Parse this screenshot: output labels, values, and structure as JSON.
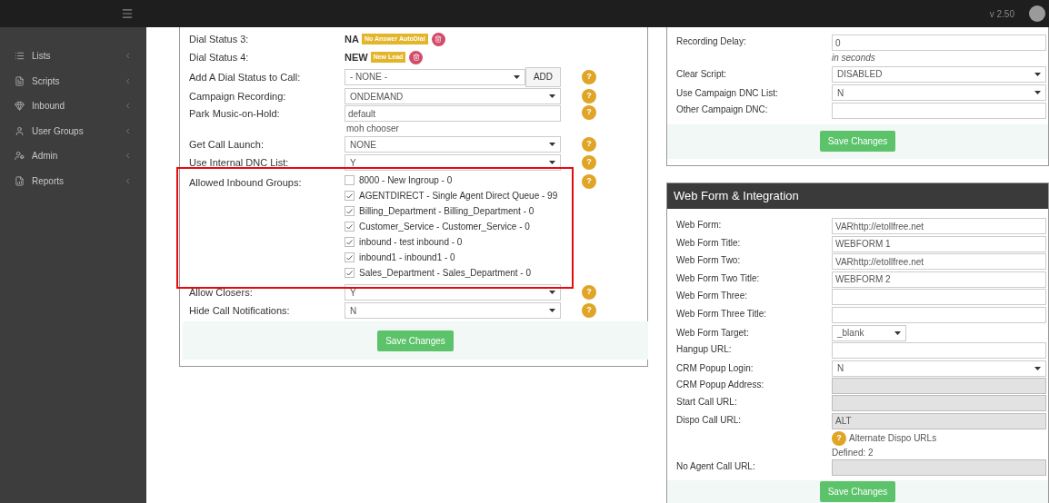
{
  "header": {
    "version": "v 2.50"
  },
  "sidebar": {
    "items": [
      {
        "label": "Lists"
      },
      {
        "label": "Scripts"
      },
      {
        "label": "Inbound"
      },
      {
        "label": "User Groups"
      },
      {
        "label": "Admin"
      },
      {
        "label": "Reports"
      }
    ]
  },
  "left_panel": {
    "rows": [
      {
        "kind": "status",
        "label": "Dial Status 3:",
        "code": "NA",
        "badge": "No Answer AutoDial"
      },
      {
        "kind": "status",
        "label": "Dial Status 4:",
        "code": "NEW",
        "badge": "New Lead"
      },
      {
        "kind": "select_add",
        "label": "Add A Dial Status to Call:",
        "value": "- NONE -",
        "button": "ADD",
        "help": "?"
      },
      {
        "kind": "select",
        "label": "Campaign Recording:",
        "value": "ONDEMAND",
        "help": "?"
      },
      {
        "kind": "input",
        "label": "Park Music-on-Hold:",
        "value": "default",
        "note": "moh chooser",
        "help": "?"
      },
      {
        "kind": "select",
        "label": "Get Call Launch:",
        "value": "NONE",
        "help": "?"
      },
      {
        "kind": "select",
        "label": "Use Internal DNC List:",
        "value": "Y",
        "help": "?"
      },
      {
        "kind": "checklist",
        "label": "Allowed Inbound Groups:",
        "help": "?",
        "highlighted": true,
        "options": [
          {
            "label": "8000 - New Ingroup - 0",
            "checked": false
          },
          {
            "label": "AGENTDIRECT - Single Agent Direct Queue - 99",
            "checked": true
          },
          {
            "label": "Billing_Department - Billing_Department - 0",
            "checked": true
          },
          {
            "label": "Customer_Service - Customer_Service - 0",
            "checked": true
          },
          {
            "label": "inbound - test inbound - 0",
            "checked": true
          },
          {
            "label": "inbound1 - inbound1 - 0",
            "checked": true
          },
          {
            "label": "Sales_Department - Sales_Department - 0",
            "checked": true
          }
        ]
      },
      {
        "kind": "select",
        "label": "Allow Closers:",
        "value": "Y",
        "help": "?"
      },
      {
        "kind": "select",
        "label": "Hide Call Notifications:",
        "value": "N",
        "help": "?"
      }
    ],
    "save": "Save Changes"
  },
  "right_top_panel": {
    "rows": [
      {
        "kind": "input",
        "label": "Recording Delay:",
        "value": "0",
        "note": "in seconds"
      },
      {
        "kind": "select",
        "label": "Clear Script:",
        "value": "DISABLED"
      },
      {
        "kind": "select",
        "label": "Use Campaign DNC List:",
        "value": "N"
      },
      {
        "kind": "input",
        "label": "Other Campaign DNC:",
        "value": ""
      }
    ],
    "save": "Save Changes"
  },
  "web_form_panel": {
    "title": "Web Form & Integration",
    "rows": [
      {
        "kind": "input",
        "label": "Web Form:",
        "value": "VARhttp://etollfree.net",
        "disabled": false
      },
      {
        "kind": "input",
        "label": "Web Form Title:",
        "value": "WEBFORM 1",
        "disabled": false
      },
      {
        "kind": "input",
        "label": "Web Form Two:",
        "value": "VARhttp://etollfree.net",
        "disabled": false
      },
      {
        "kind": "input",
        "label": "Web Form Two Title:",
        "value": "WEBFORM 2",
        "disabled": false
      },
      {
        "kind": "input",
        "label": "Web Form Three:",
        "value": "",
        "disabled": false
      },
      {
        "kind": "input",
        "label": "Web Form Three Title:",
        "value": "",
        "disabled": false
      },
      {
        "kind": "small_select",
        "label": "Web Form Target:",
        "value": "_blank"
      },
      {
        "kind": "input",
        "label": "Hangup URL:",
        "value": "",
        "disabled": false
      },
      {
        "kind": "select",
        "label": "CRM Popup Login:",
        "value": "N"
      },
      {
        "kind": "input",
        "label": "CRM Popup Address:",
        "value": "",
        "disabled": true
      },
      {
        "kind": "input",
        "label": "Start Call URL:",
        "value": "",
        "disabled": true
      },
      {
        "kind": "input",
        "label": "Dispo Call URL:",
        "value": "ALT",
        "disabled": true,
        "help": "?",
        "help_note": "Alternate Dispo URLs",
        "note": "Defined: 2"
      },
      {
        "kind": "input",
        "label": "No Agent Call URL:",
        "value": "",
        "disabled": true
      }
    ],
    "save": "Save Changes"
  }
}
